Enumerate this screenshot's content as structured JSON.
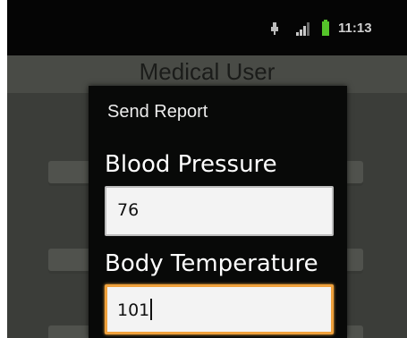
{
  "status_bar": {
    "time": "11:13",
    "icons": [
      "usb-icon",
      "signal-icon",
      "battery-icon"
    ],
    "battery_color": "#55c52a"
  },
  "app": {
    "title": "Medical User"
  },
  "dialog": {
    "title": "Send Report",
    "fields": [
      {
        "label": "Blood Pressure",
        "value": "76",
        "focused": false
      },
      {
        "label": "Body Temperature",
        "value": "101",
        "focused": true
      }
    ],
    "focus_color": "#f0a13c"
  }
}
